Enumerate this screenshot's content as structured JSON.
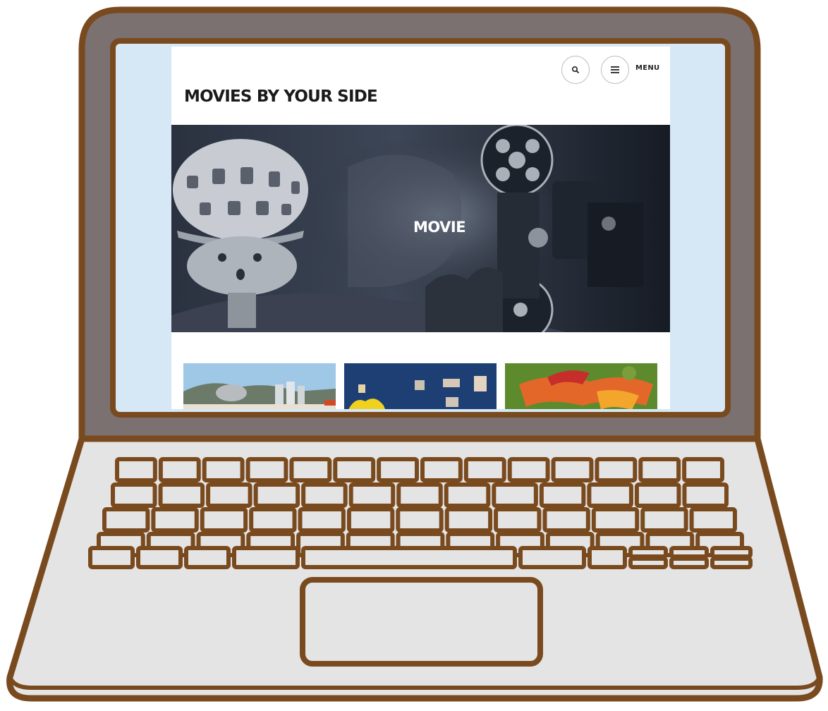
{
  "site": {
    "title": "MOVIES BY YOUR SIDE",
    "menu_label": "MENU"
  },
  "header": {
    "search_icon": "search-icon",
    "menu_icon": "hamburger-icon"
  },
  "hero": {
    "title": "MOVIE"
  },
  "thumbnails": [
    {
      "name": "landscape-thumbnail"
    },
    {
      "name": "wall-frames-thumbnail"
    },
    {
      "name": "autumn-leaves-thumbnail"
    }
  ],
  "colors": {
    "outline": "#7a4a1f",
    "bezel": "#7b7171",
    "body": "#e4e4e4",
    "screen_bg": "#d6e8f5",
    "hero_dark": "#1b2230"
  }
}
